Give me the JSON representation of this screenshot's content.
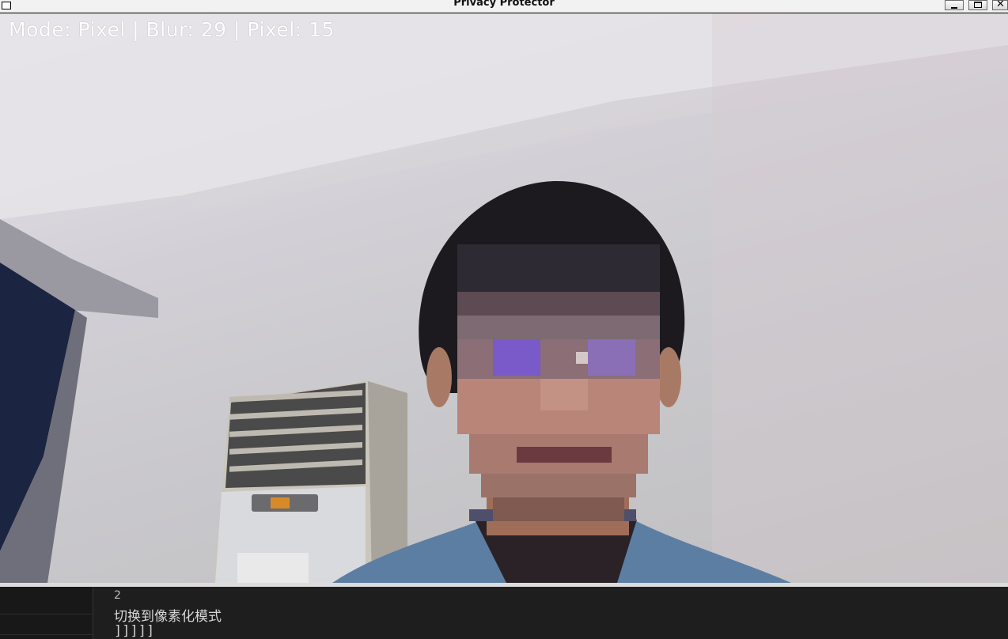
{
  "window": {
    "title": "Privacy Protector",
    "controls": {
      "minimize_icon": "minimize-icon",
      "maximize_icon": "maximize-icon",
      "close_icon": "close-icon",
      "close_glyph": "✕"
    }
  },
  "overlay": {
    "status_text": "Mode: Pixel | Blur: 29 | Pixel: 15",
    "mode": "Pixel",
    "blur": 29,
    "pixel": 15
  },
  "terminal": {
    "lines": [
      "2",
      "切换到像素化模式",
      "]]]]]"
    ]
  }
}
